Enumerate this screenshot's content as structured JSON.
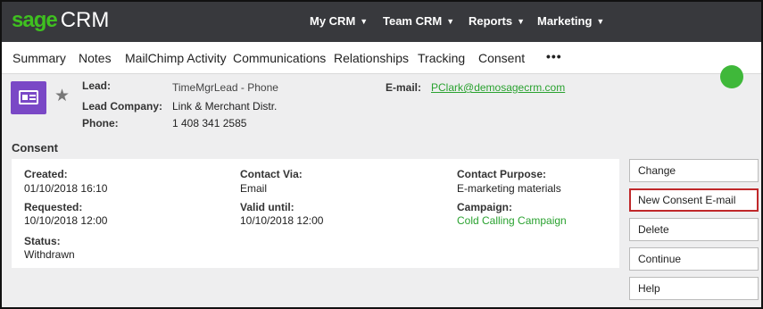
{
  "app": {
    "logo_brand": "sage",
    "logo_product": "CRM"
  },
  "top_menu": [
    {
      "label": "My CRM"
    },
    {
      "label": "Team CRM"
    },
    {
      "label": "Reports"
    },
    {
      "label": "Marketing"
    }
  ],
  "tabs": [
    {
      "label": "Summary"
    },
    {
      "label": "Notes"
    },
    {
      "label": "MailChimp Activity"
    },
    {
      "label": "Communications"
    },
    {
      "label": "Relationships"
    },
    {
      "label": "Tracking"
    },
    {
      "label": "Consent"
    },
    {
      "label": "•••"
    }
  ],
  "header": {
    "lead_label": "Lead:",
    "lead_value": "TimeMgrLead - Phone",
    "company_label": "Lead Company:",
    "company_value": "Link & Merchant Distr.",
    "phone_label": "Phone:",
    "phone_value": "1 408 341 2585",
    "email_label": "E-mail:",
    "email_value": "PClark@demosagecrm.com"
  },
  "consent": {
    "title": "Consent",
    "created_label": "Created:",
    "created_value": "01/10/2018 16:10",
    "requested_label": "Requested:",
    "requested_value": "10/10/2018 12:00",
    "status_label": "Status:",
    "status_value": "Withdrawn",
    "contact_via_label": "Contact Via:",
    "contact_via_value": "Email",
    "valid_until_label": "Valid until:",
    "valid_until_value": "10/10/2018 12:00",
    "purpose_label": "Contact Purpose:",
    "purpose_value": "E-marketing materials",
    "campaign_label": "Campaign:",
    "campaign_value": "Cold Calling Campaign"
  },
  "actions": [
    {
      "label": "Change"
    },
    {
      "label": "New Consent E-mail"
    },
    {
      "label": "Delete"
    },
    {
      "label": "Continue"
    },
    {
      "label": "Help"
    }
  ],
  "colors": {
    "brand_green": "#3fc020",
    "topbar": "#38393d",
    "entity_purple": "#7a48c6",
    "highlight_red": "#c0282a",
    "link_green": "#2aa230"
  },
  "icons": {
    "entity": "lead-card-icon",
    "favorite": "star-icon",
    "add": "add-circle-icon",
    "dropdown": "caret-down-icon"
  }
}
